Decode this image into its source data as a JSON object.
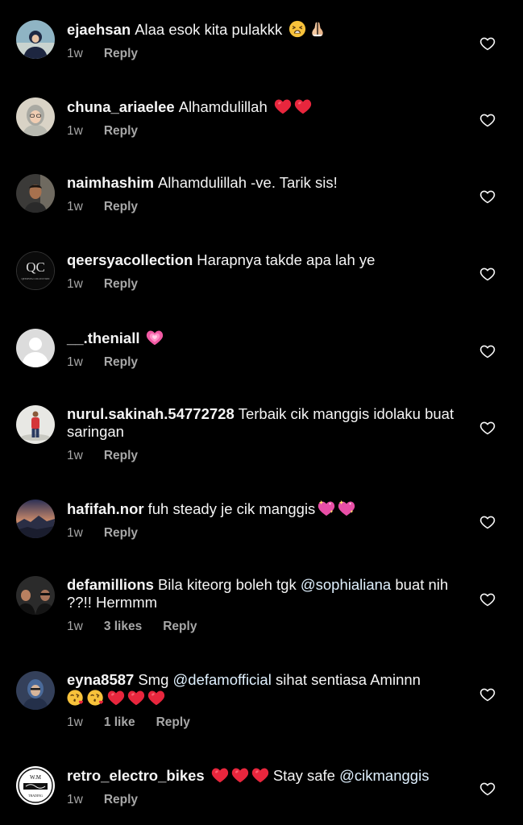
{
  "colors": {
    "background": "#000000",
    "text": "#f5f5f5",
    "meta": "#a8a8a8",
    "heart_emoji": "#e0245e"
  },
  "comments": [
    {
      "username": "ejaehsan",
      "text": "Alaa esok kita pulakkk",
      "emojis": [
        "tired-face-emoji",
        "folded-hands-emoji"
      ],
      "time": "1w",
      "likes": "",
      "reply": "Reply"
    },
    {
      "username": "chuna_ariaelee",
      "text": "Alhamdulillah",
      "emojis": [
        "red-heart-emoji",
        "red-heart-emoji"
      ],
      "time": "1w",
      "likes": "",
      "reply": "Reply"
    },
    {
      "username": "naimhashim",
      "text": "Alhamdulillah -ve. Tarik sis!",
      "emojis": [],
      "time": "1w",
      "likes": "",
      "reply": "Reply"
    },
    {
      "username": "qeersyacollection",
      "text": "Harapnya takde apa lah ye",
      "emojis": [],
      "avatar_text": "QC",
      "avatar_subtext": "QEERSYA COLLECTION",
      "time": "1w",
      "likes": "",
      "reply": "Reply"
    },
    {
      "username": "__.theniall",
      "text": "",
      "emojis": [
        "growing-heart-emoji"
      ],
      "time": "1w",
      "likes": "",
      "reply": "Reply"
    },
    {
      "username": "nurul.sakinah.54772728",
      "text": "Terbaik cik manggis idolaku buat saringan",
      "emojis": [],
      "time": "1w",
      "likes": "",
      "reply": "Reply"
    },
    {
      "username": "hafifah.nor",
      "text": "fuh steady je cik manggis",
      "emojis": [
        "sparkling-heart-emoji",
        "sparkling-heart-emoji"
      ],
      "time": "1w",
      "likes": "",
      "reply": "Reply"
    },
    {
      "username": "defamillions",
      "text_before": "Bila kiteorg boleh tgk",
      "mention": "@sophialiana",
      "text_after": "buat nih ??!! Hermmm",
      "emojis": [],
      "time": "1w",
      "likes": "3 likes",
      "reply": "Reply"
    },
    {
      "username": "eyna8587",
      "text_before": "Smg",
      "mention": "@defamofficial",
      "text_after": "sihat sentiasa Aminnn",
      "emojis": [
        "kissing-face-emoji",
        "kissing-face-emoji",
        "red-heart-emoji",
        "red-heart-emoji",
        "red-heart-emoji"
      ],
      "time": "1w",
      "likes": "1 like",
      "reply": "Reply"
    },
    {
      "username": "retro_electro_bikes",
      "emojis": [
        "red-heart-emoji",
        "red-heart-emoji",
        "red-heart-emoji"
      ],
      "text_before": "Stay safe",
      "mention": "@cikmanggis",
      "avatar_text": "W.M",
      "avatar_subtext": "TRADING",
      "time": "1w",
      "likes": "",
      "reply": "Reply"
    }
  ]
}
